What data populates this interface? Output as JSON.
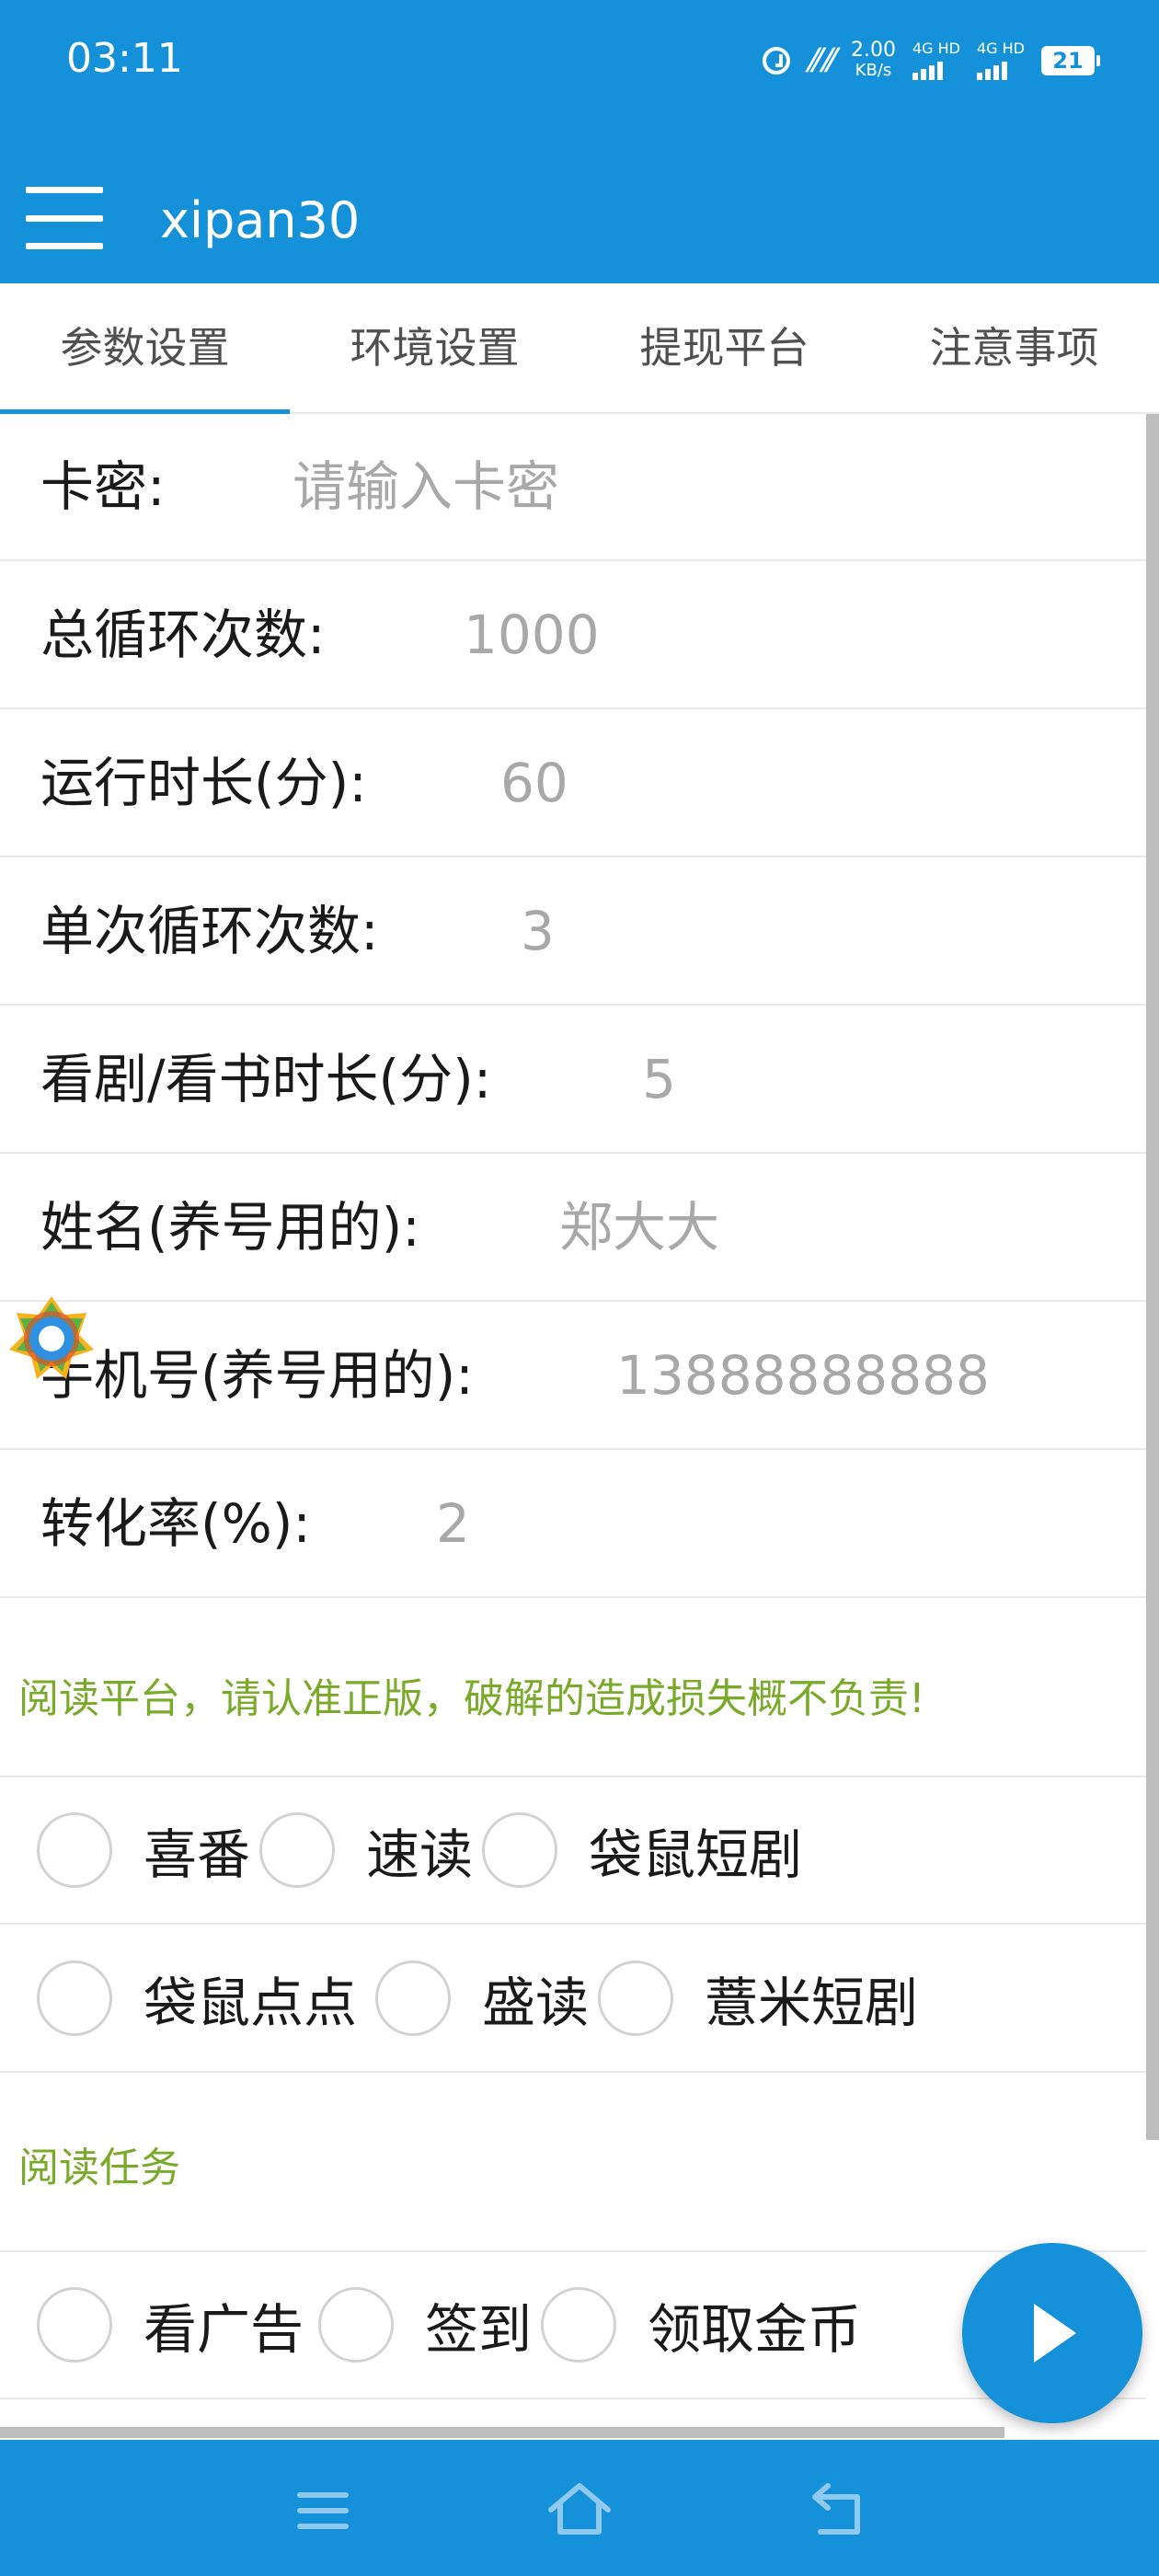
{
  "status_bar": {
    "time": "03:11",
    "speed_value": "2.00",
    "speed_unit": "KB/s",
    "network_1": "4G HD",
    "network_2": "4G HD",
    "battery": "21",
    "icons": [
      "alarm-icon",
      "signal-icon",
      "battery-icon"
    ]
  },
  "header": {
    "title": "xipan30",
    "menu_icon": "hamburger-menu-icon"
  },
  "tabs": [
    {
      "label": "参数设置",
      "active": true
    },
    {
      "label": "环境设置",
      "active": false
    },
    {
      "label": "提现平台",
      "active": false
    },
    {
      "label": "注意事项",
      "active": false
    }
  ],
  "fields": {
    "card_key": {
      "label": "卡密:",
      "placeholder": "请输入卡密"
    },
    "total_loops": {
      "label": "总循环次数:",
      "value": "1000"
    },
    "run_duration": {
      "label": "运行时长(分):",
      "value": "60"
    },
    "single_loops": {
      "label": "单次循环次数:",
      "value": "3"
    },
    "watch_duration": {
      "label": "看剧/看书时长(分):",
      "value": "5"
    },
    "name": {
      "label": "姓名(养号用的):",
      "value": "郑大大"
    },
    "phone": {
      "label": "手机号(养号用的):",
      "value": "13888888888"
    },
    "conversion": {
      "label": "转化率(%):",
      "value": "2"
    }
  },
  "notices": {
    "platform": "阅读平台，请认准正版，破解的造成损失概不负责!",
    "tasks": "阅读任务"
  },
  "platform_options": [
    [
      "喜番",
      "速读",
      "袋鼠短剧"
    ],
    [
      "袋鼠点点",
      "盛读",
      "薏米短剧"
    ]
  ],
  "task_options": [
    "看广告",
    "签到",
    "领取金币"
  ],
  "colors": {
    "primary": "#1591da",
    "notice_green": "#7aaa2a",
    "placeholder": "#a8a8a8"
  },
  "fab_icon": "play-icon",
  "navbar_icons": [
    "menu-icon",
    "home-icon",
    "back-icon"
  ]
}
